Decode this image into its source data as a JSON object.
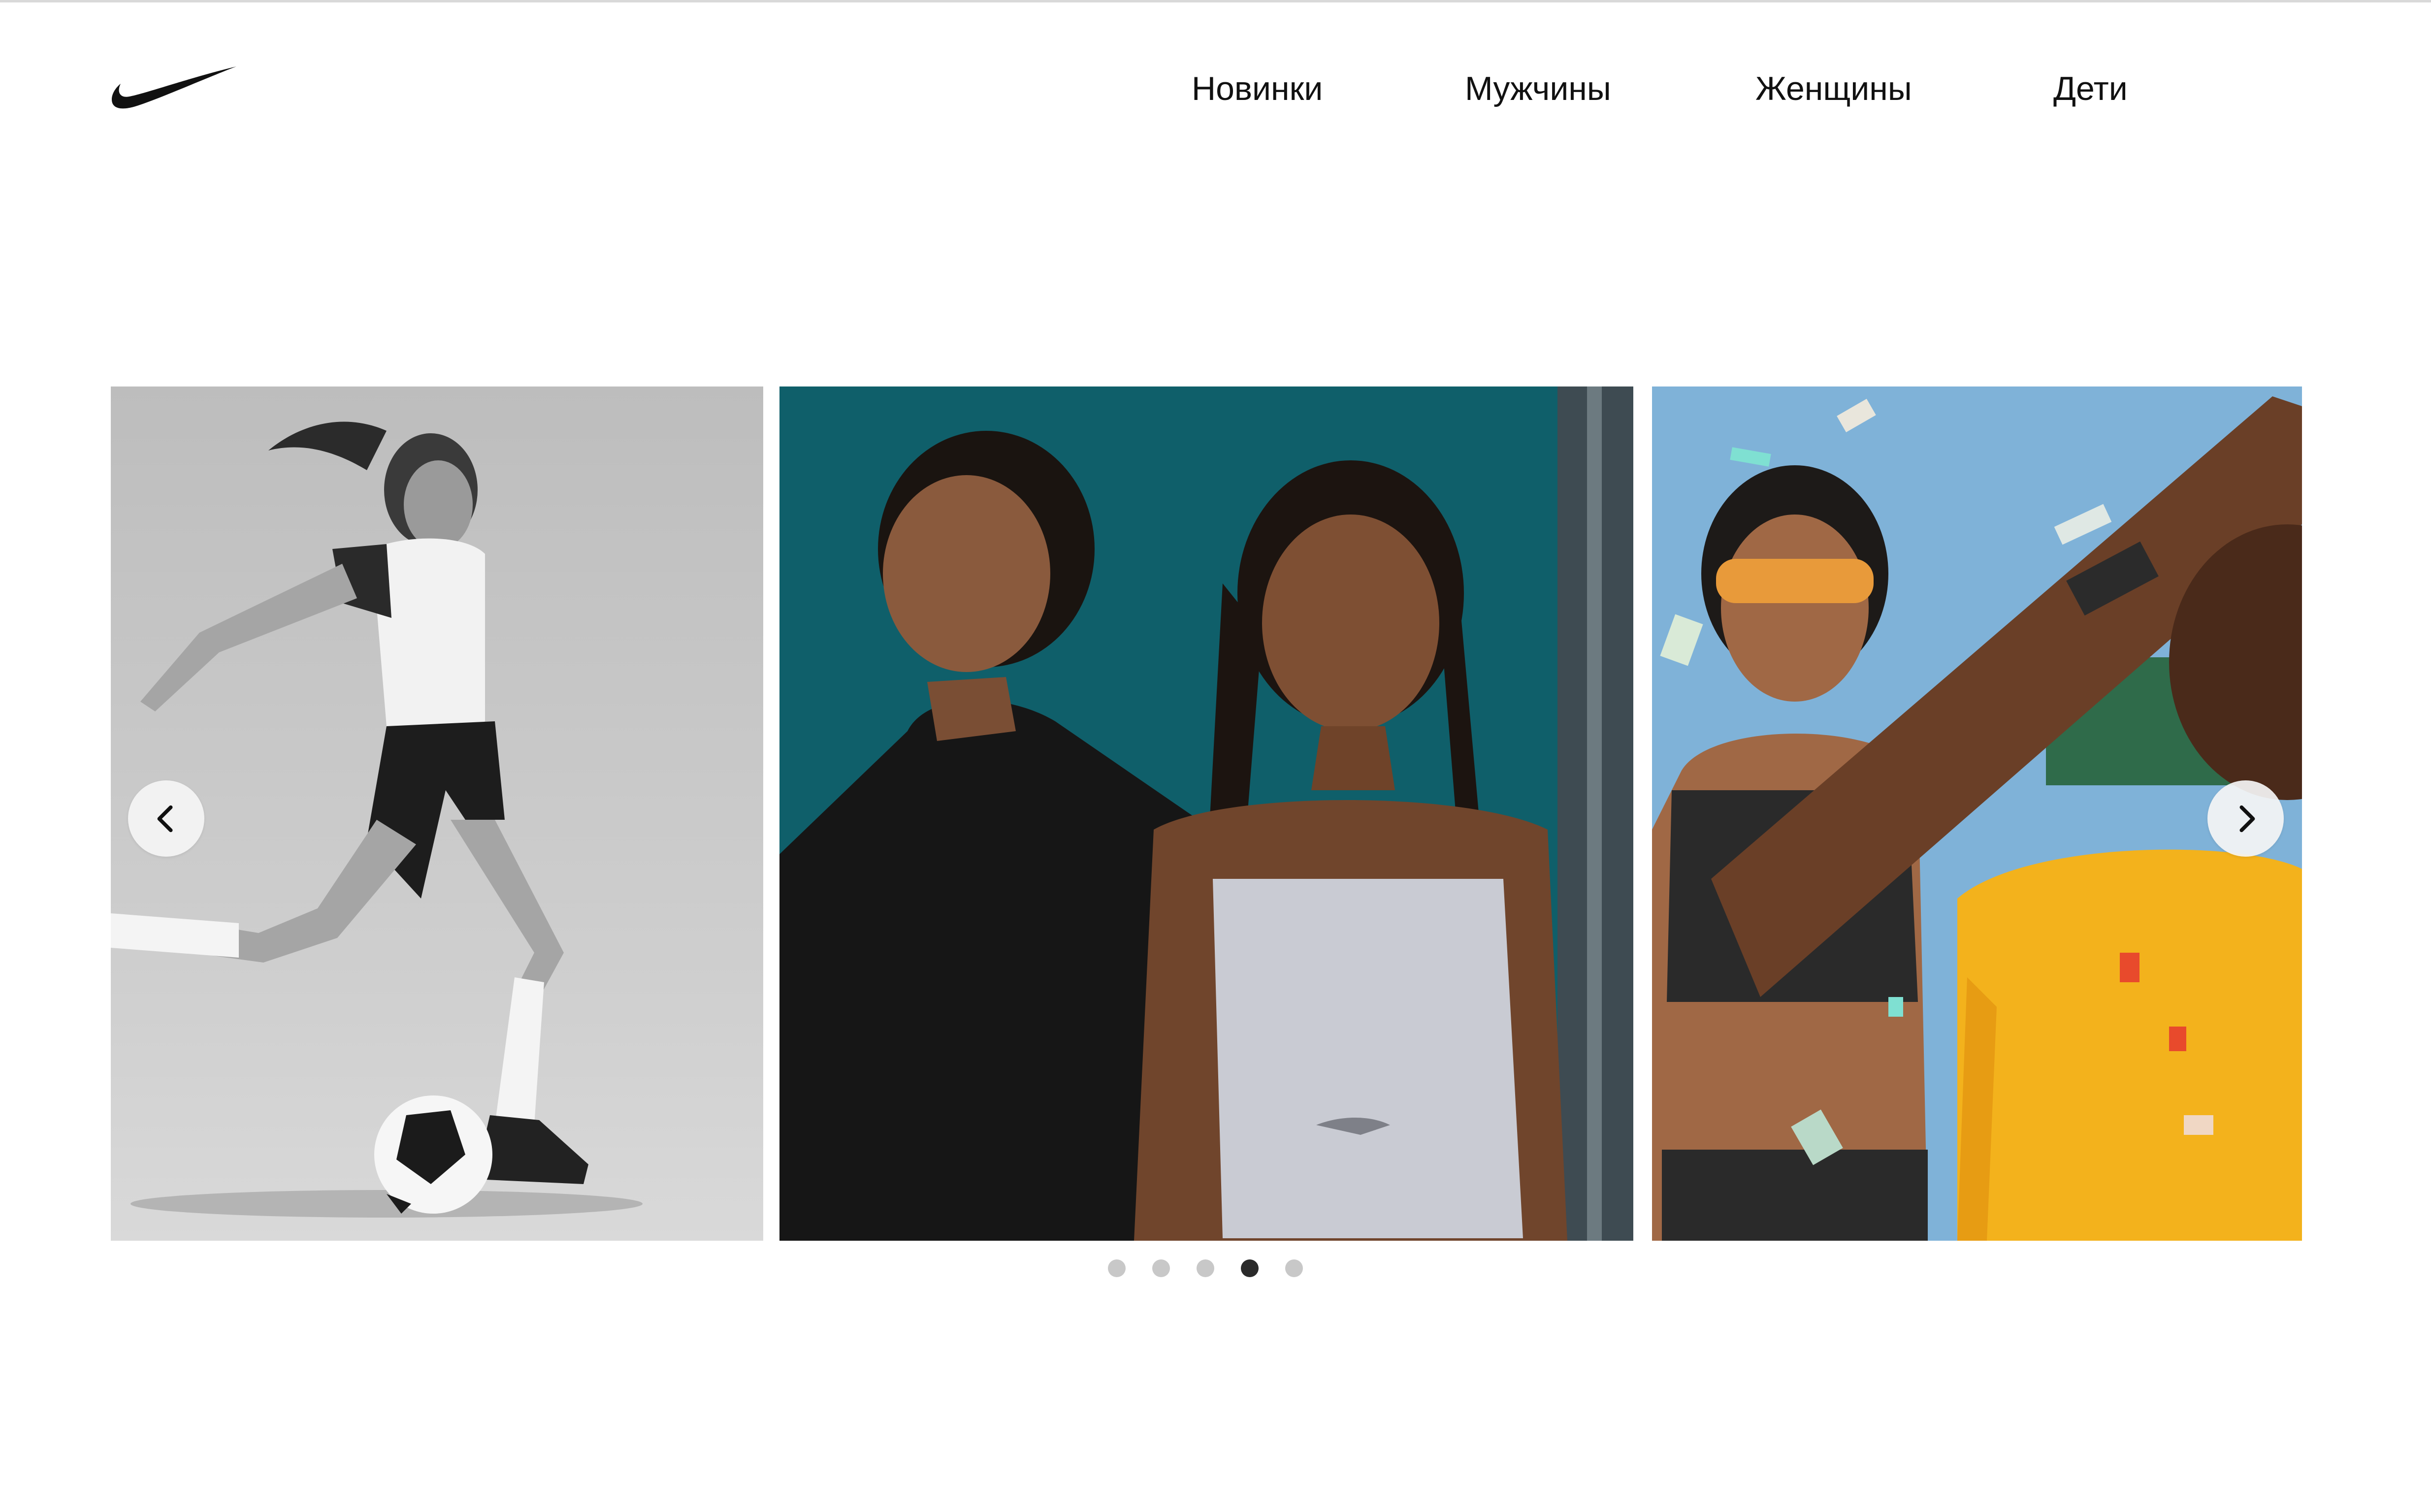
{
  "header": {
    "logo_icon": "nike-swoosh-icon",
    "nav": [
      {
        "label": "Новинки"
      },
      {
        "label": "Мужчины"
      },
      {
        "label": "Женщины"
      },
      {
        "label": "Дети"
      }
    ]
  },
  "carousel": {
    "slides": [
      {
        "image": "soccer-player-photo",
        "style": "grayscale"
      },
      {
        "image": "two-women-teal-wall-photo",
        "style": "color"
      },
      {
        "image": "celebration-confetti-photo",
        "style": "color"
      }
    ],
    "prev_icon": "chevron-left-icon",
    "next_icon": "chevron-right-icon",
    "dots_total": 5,
    "active_dot": 4
  },
  "colors": {
    "background": "#ffffff",
    "text": "#111111",
    "dot_inactive": "#c8c8c8",
    "dot_active": "#2a2a2a",
    "teal_wall": "#0f5f6a",
    "sky": "#7fb2d8",
    "jersey_yellow": "#f3b21c"
  }
}
